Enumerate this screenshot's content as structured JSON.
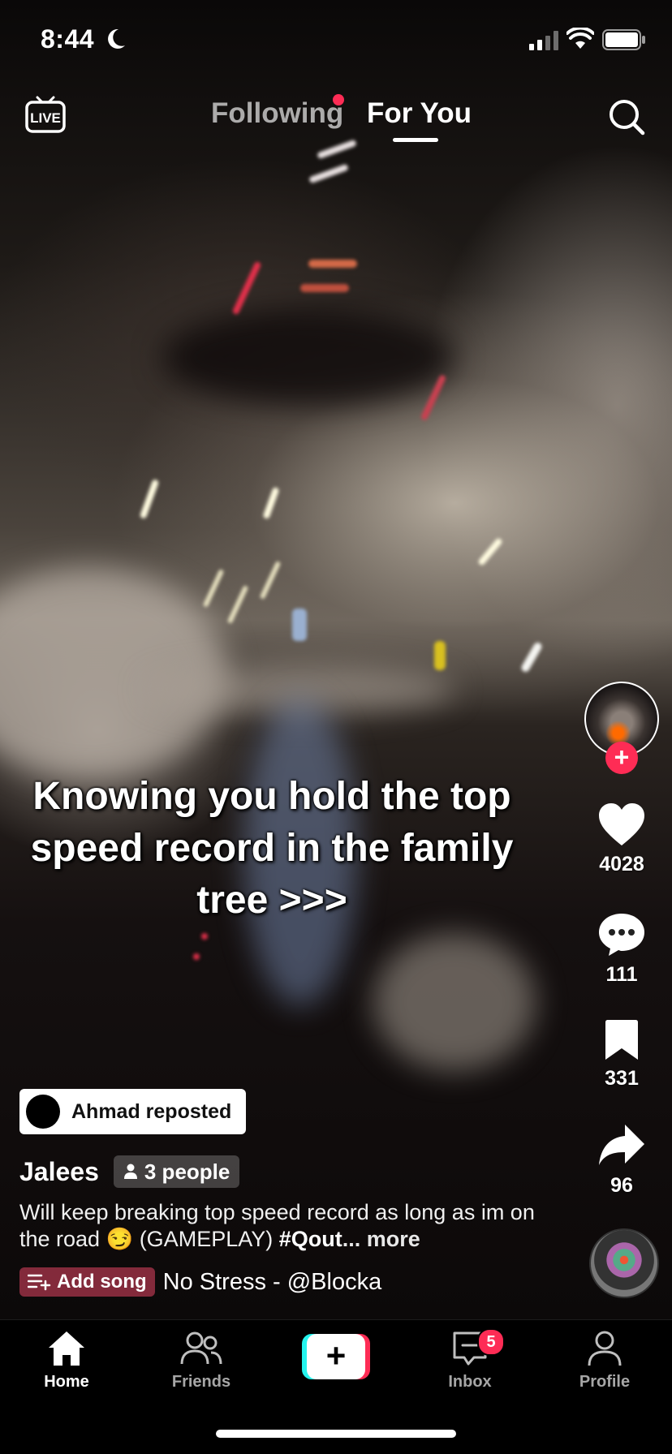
{
  "status_bar": {
    "time": "8:44",
    "icons": [
      "moon-icon",
      "cellular-signal-icon",
      "wifi-icon",
      "battery-icon"
    ]
  },
  "top_nav": {
    "live_label": "LIVE",
    "tabs": [
      {
        "label": "Following",
        "has_notification_dot": true
      },
      {
        "label": "For You",
        "active": true
      }
    ],
    "search_icon": "search-icon"
  },
  "video": {
    "overlay_text": "Knowing you hold the top speed record in the family tree >>>"
  },
  "right_rail": {
    "follow_icon": "plus-icon",
    "like_count": "4028",
    "comment_count": "111",
    "bookmark_count": "331",
    "share_count": "96"
  },
  "post": {
    "repost_label": "Ahmad reposted",
    "author": "Jalees",
    "people_badge": "3 people",
    "description_prefix": "Will keep breaking top speed record as long as im on the road 😏 (GAMEPLAY) ",
    "hashtag": "#Qout",
    "more_label": "... more",
    "add_song_label": "Add song",
    "song_title": "No Stress - @Blocka"
  },
  "bottom_tabs": [
    {
      "label": "Home",
      "icon": "home-icon",
      "active": true
    },
    {
      "label": "Friends",
      "icon": "friends-icon"
    },
    {
      "label": "",
      "icon": "create-plus-icon"
    },
    {
      "label": "Inbox",
      "icon": "inbox-icon",
      "badge": "5"
    },
    {
      "label": "Profile",
      "icon": "profile-icon"
    }
  ],
  "colors": {
    "accent": "#fe2c55",
    "cyan": "#25f4ee"
  }
}
